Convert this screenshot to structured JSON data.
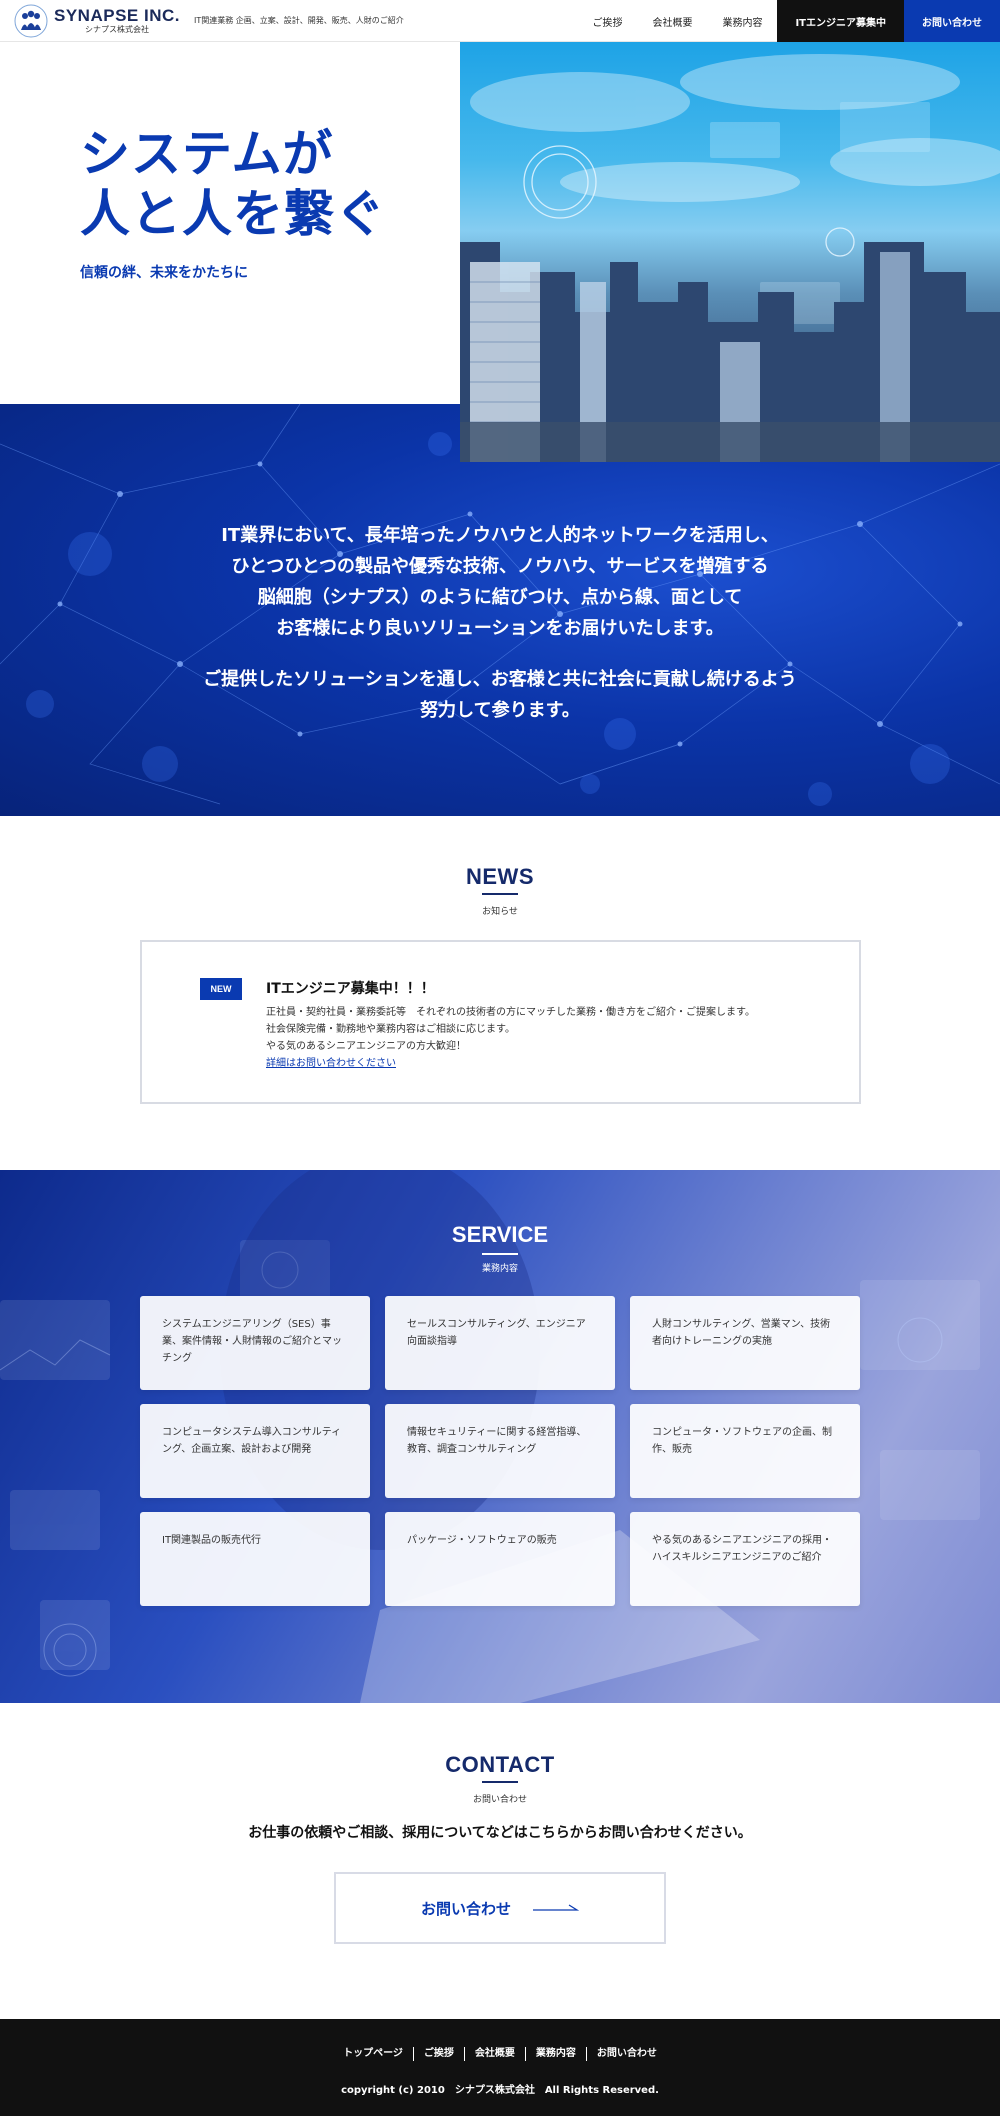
{
  "header": {
    "logo_en": "SYNAPSE INC.",
    "logo_jp": "シナプス株式会社",
    "tagline": "IT関連業務 企画、立案、設計、開発、販売、人財のご紹介",
    "nav": {
      "greeting": "ご挨拶",
      "company": "会社概要",
      "business": "業務内容",
      "recruit": "ITエンジニア募集中",
      "contact": "お問い合わせ"
    }
  },
  "hero": {
    "title_line1": "システムが",
    "title_line2": "人と人を繋ぐ",
    "subtitle": "信頼の絆、未来をかたちに"
  },
  "intro": {
    "p1_lines": [
      "IT業界において、長年培ったノウハウと人的ネットワークを活用し、",
      "ひとつひとつの製品や優秀な技術、ノウハウ、サービスを増殖する",
      "脳細胞（シナプス）のように結びつけ、点から線、面として",
      "お客様により良いソリューションをお届けいたします。"
    ],
    "p2_lines": [
      "ご提供したソリューションを通し、お客様と共に社会に貢献し続けるよう",
      "努力して参ります。"
    ]
  },
  "news": {
    "heading": "NEWS",
    "subheading": "お知らせ",
    "badge": "NEW",
    "title": "ITエンジニア募集中！！！",
    "lines": [
      "正社員・契約社員・業務委託等　それぞれの技術者の方にマッチした業務・働き方をご紹介・ご提案します。",
      "社会保険完備・勤務地や業務内容はご相談に応じます。",
      "やる気のあるシニアエンジニアの方大歓迎！"
    ],
    "link": "詳細はお問い合わせください"
  },
  "service": {
    "heading": "SERVICE",
    "subheading": "業務内容",
    "items": [
      "システムエンジニアリング（SES）事業、案件情報・人財情報のご紹介とマッチング",
      "セールスコンサルティング、エンジニア向面談指導",
      "人財コンサルティング、営業マン、技術者向けトレーニングの実施",
      "コンピュータシステム導入コンサルティング、企画立案、設計および開発",
      "情報セキュリティーに関する経営指導、教育、調査コンサルティング",
      "コンピュータ・ソフトウェアの企画、制作、販売",
      "IT関連製品の販売代行",
      "パッケージ・ソフトウェアの販売",
      "やる気のあるシニアエンジニアの採用・ハイスキルシニアエンジニアのご紹介"
    ]
  },
  "contact": {
    "heading": "CONTACT",
    "subheading": "お問い合わせ",
    "lead": "お仕事の依頼やご相談、採用についてなどはこちらからお問い合わせください。",
    "button": "お問い合わせ"
  },
  "footer": {
    "nav": [
      "トップページ",
      "ご挨拶",
      "会社概要",
      "業務内容",
      "お問い合わせ"
    ],
    "copyright": "copyright (c) 2010　シナプス株式会社　All Rights Reserved."
  },
  "colors": {
    "brand_blue": "#0a3ab1",
    "navy": "#152a6b",
    "footer_bg": "#111111"
  }
}
